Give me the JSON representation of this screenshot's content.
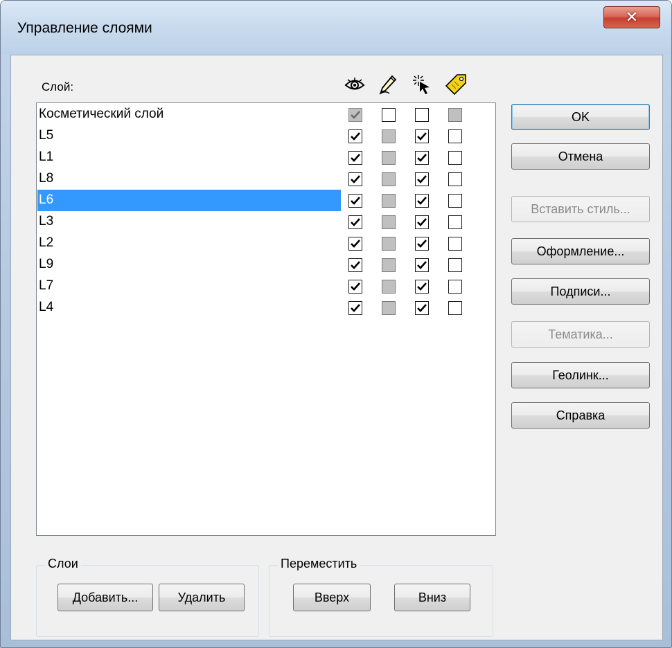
{
  "window": {
    "title": "Управление слоями",
    "close_glyph": "✕"
  },
  "list": {
    "header_label": "Слой:",
    "column_icons": [
      "eye-icon",
      "pencil-icon",
      "pointer-icon",
      "tag-icon"
    ],
    "rows": [
      {
        "name": "Косметический слой",
        "visible": "checked-disabled",
        "editable": "unchecked",
        "selectable": "unchecked",
        "labels": "gray"
      },
      {
        "name": "L5",
        "visible": "checked",
        "editable": "gray",
        "selectable": "checked",
        "labels": "unchecked"
      },
      {
        "name": "L1",
        "visible": "checked",
        "editable": "gray",
        "selectable": "checked",
        "labels": "unchecked"
      },
      {
        "name": "L8",
        "visible": "checked",
        "editable": "gray",
        "selectable": "checked",
        "labels": "unchecked"
      },
      {
        "name": "L6",
        "visible": "checked",
        "editable": "gray",
        "selectable": "checked",
        "labels": "unchecked",
        "selected": true
      },
      {
        "name": "L3",
        "visible": "checked",
        "editable": "gray",
        "selectable": "checked",
        "labels": "unchecked"
      },
      {
        "name": "L2",
        "visible": "checked",
        "editable": "gray",
        "selectable": "checked",
        "labels": "unchecked"
      },
      {
        "name": "L9",
        "visible": "checked",
        "editable": "gray",
        "selectable": "checked",
        "labels": "unchecked"
      },
      {
        "name": "L7",
        "visible": "checked",
        "editable": "gray",
        "selectable": "checked",
        "labels": "unchecked"
      },
      {
        "name": "L4",
        "visible": "checked",
        "editable": "gray",
        "selectable": "checked",
        "labels": "unchecked"
      }
    ]
  },
  "buttons": {
    "ok": "OK",
    "cancel": "Отмена",
    "paste_style": "Вставить стиль...",
    "display": "Оформление...",
    "labels": "Подписи...",
    "thematic": "Тематика...",
    "geolink": "Геолинк...",
    "help": "Справка"
  },
  "layers_group": {
    "title": "Слои",
    "add": "Добавить...",
    "remove": "Удалить"
  },
  "move_group": {
    "title": "Переместить",
    "up": "Вверх",
    "down": "Вниз"
  },
  "colors": {
    "selection": "#3399ff",
    "dialog_bg": "#f0f0f0",
    "close_button": "#c7402f"
  }
}
